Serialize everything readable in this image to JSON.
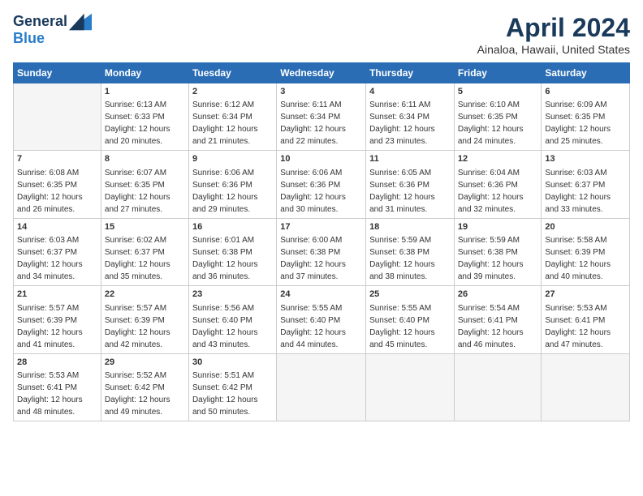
{
  "logo": {
    "line1": "General",
    "line2": "Blue"
  },
  "title": "April 2024",
  "subtitle": "Ainaloa, Hawaii, United States",
  "days_of_week": [
    "Sunday",
    "Monday",
    "Tuesday",
    "Wednesday",
    "Thursday",
    "Friday",
    "Saturday"
  ],
  "weeks": [
    [
      {
        "day": "",
        "empty": true
      },
      {
        "day": "1",
        "sunrise": "6:13 AM",
        "sunset": "6:33 PM",
        "daylight": "12 hours and 20 minutes."
      },
      {
        "day": "2",
        "sunrise": "6:12 AM",
        "sunset": "6:34 PM",
        "daylight": "12 hours and 21 minutes."
      },
      {
        "day": "3",
        "sunrise": "6:11 AM",
        "sunset": "6:34 PM",
        "daylight": "12 hours and 22 minutes."
      },
      {
        "day": "4",
        "sunrise": "6:11 AM",
        "sunset": "6:34 PM",
        "daylight": "12 hours and 23 minutes."
      },
      {
        "day": "5",
        "sunrise": "6:10 AM",
        "sunset": "6:35 PM",
        "daylight": "12 hours and 24 minutes."
      },
      {
        "day": "6",
        "sunrise": "6:09 AM",
        "sunset": "6:35 PM",
        "daylight": "12 hours and 25 minutes."
      }
    ],
    [
      {
        "day": "7",
        "sunrise": "6:08 AM",
        "sunset": "6:35 PM",
        "daylight": "12 hours and 26 minutes."
      },
      {
        "day": "8",
        "sunrise": "6:07 AM",
        "sunset": "6:35 PM",
        "daylight": "12 hours and 27 minutes."
      },
      {
        "day": "9",
        "sunrise": "6:06 AM",
        "sunset": "6:36 PM",
        "daylight": "12 hours and 29 minutes."
      },
      {
        "day": "10",
        "sunrise": "6:06 AM",
        "sunset": "6:36 PM",
        "daylight": "12 hours and 30 minutes."
      },
      {
        "day": "11",
        "sunrise": "6:05 AM",
        "sunset": "6:36 PM",
        "daylight": "12 hours and 31 minutes."
      },
      {
        "day": "12",
        "sunrise": "6:04 AM",
        "sunset": "6:36 PM",
        "daylight": "12 hours and 32 minutes."
      },
      {
        "day": "13",
        "sunrise": "6:03 AM",
        "sunset": "6:37 PM",
        "daylight": "12 hours and 33 minutes."
      }
    ],
    [
      {
        "day": "14",
        "sunrise": "6:03 AM",
        "sunset": "6:37 PM",
        "daylight": "12 hours and 34 minutes."
      },
      {
        "day": "15",
        "sunrise": "6:02 AM",
        "sunset": "6:37 PM",
        "daylight": "12 hours and 35 minutes."
      },
      {
        "day": "16",
        "sunrise": "6:01 AM",
        "sunset": "6:38 PM",
        "daylight": "12 hours and 36 minutes."
      },
      {
        "day": "17",
        "sunrise": "6:00 AM",
        "sunset": "6:38 PM",
        "daylight": "12 hours and 37 minutes."
      },
      {
        "day": "18",
        "sunrise": "5:59 AM",
        "sunset": "6:38 PM",
        "daylight": "12 hours and 38 minutes."
      },
      {
        "day": "19",
        "sunrise": "5:59 AM",
        "sunset": "6:38 PM",
        "daylight": "12 hours and 39 minutes."
      },
      {
        "day": "20",
        "sunrise": "5:58 AM",
        "sunset": "6:39 PM",
        "daylight": "12 hours and 40 minutes."
      }
    ],
    [
      {
        "day": "21",
        "sunrise": "5:57 AM",
        "sunset": "6:39 PM",
        "daylight": "12 hours and 41 minutes."
      },
      {
        "day": "22",
        "sunrise": "5:57 AM",
        "sunset": "6:39 PM",
        "daylight": "12 hours and 42 minutes."
      },
      {
        "day": "23",
        "sunrise": "5:56 AM",
        "sunset": "6:40 PM",
        "daylight": "12 hours and 43 minutes."
      },
      {
        "day": "24",
        "sunrise": "5:55 AM",
        "sunset": "6:40 PM",
        "daylight": "12 hours and 44 minutes."
      },
      {
        "day": "25",
        "sunrise": "5:55 AM",
        "sunset": "6:40 PM",
        "daylight": "12 hours and 45 minutes."
      },
      {
        "day": "26",
        "sunrise": "5:54 AM",
        "sunset": "6:41 PM",
        "daylight": "12 hours and 46 minutes."
      },
      {
        "day": "27",
        "sunrise": "5:53 AM",
        "sunset": "6:41 PM",
        "daylight": "12 hours and 47 minutes."
      }
    ],
    [
      {
        "day": "28",
        "sunrise": "5:53 AM",
        "sunset": "6:41 PM",
        "daylight": "12 hours and 48 minutes."
      },
      {
        "day": "29",
        "sunrise": "5:52 AM",
        "sunset": "6:42 PM",
        "daylight": "12 hours and 49 minutes."
      },
      {
        "day": "30",
        "sunrise": "5:51 AM",
        "sunset": "6:42 PM",
        "daylight": "12 hours and 50 minutes."
      },
      {
        "day": "",
        "empty": true
      },
      {
        "day": "",
        "empty": true
      },
      {
        "day": "",
        "empty": true
      },
      {
        "day": "",
        "empty": true
      }
    ]
  ]
}
